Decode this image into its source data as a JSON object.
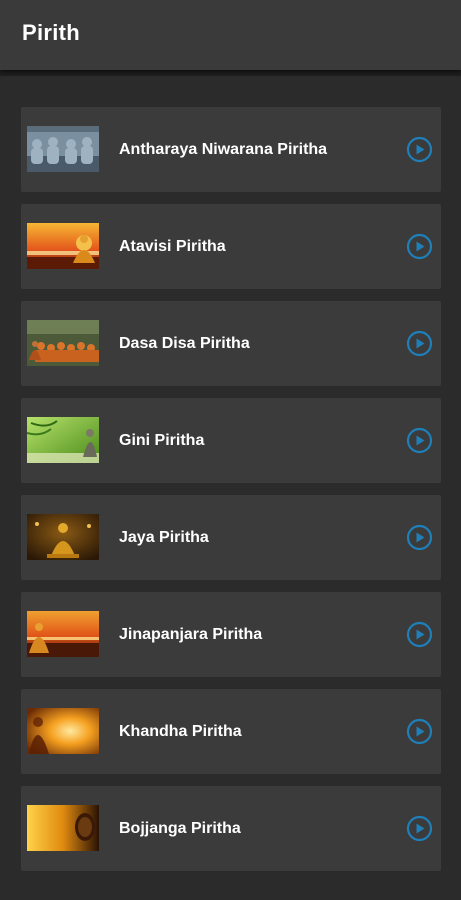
{
  "app_bar": {
    "title": "Pirith"
  },
  "colors": {
    "accent": "#1f7fb8",
    "card": "#3b3b3b",
    "background": "#2b2b2b",
    "app_bar": "#3a3a3a"
  },
  "items": [
    {
      "label": "Antharaya Niwarana Piritha",
      "thumb": "thumb-monks-statues",
      "icon": "play-circle-icon"
    },
    {
      "label": "Atavisi Piritha",
      "thumb": "thumb-buddha-sunset",
      "icon": "play-circle-icon"
    },
    {
      "label": "Dasa Disa Piritha",
      "thumb": "thumb-monks-gathering",
      "icon": "play-circle-icon"
    },
    {
      "label": "Gini Piritha",
      "thumb": "thumb-green-bamboo-buddha",
      "icon": "play-circle-icon"
    },
    {
      "label": "Jaya Piritha",
      "thumb": "thumb-golden-buddha",
      "icon": "play-circle-icon"
    },
    {
      "label": "Jinapanjara Piritha",
      "thumb": "thumb-buddha-ocean-sunset",
      "icon": "play-circle-icon"
    },
    {
      "label": "Khandha Piritha",
      "thumb": "thumb-buddha-glow",
      "icon": "play-circle-icon"
    },
    {
      "label": "Bojjanga Piritha",
      "thumb": "thumb-buddha-face-gold",
      "icon": "play-circle-icon"
    }
  ]
}
